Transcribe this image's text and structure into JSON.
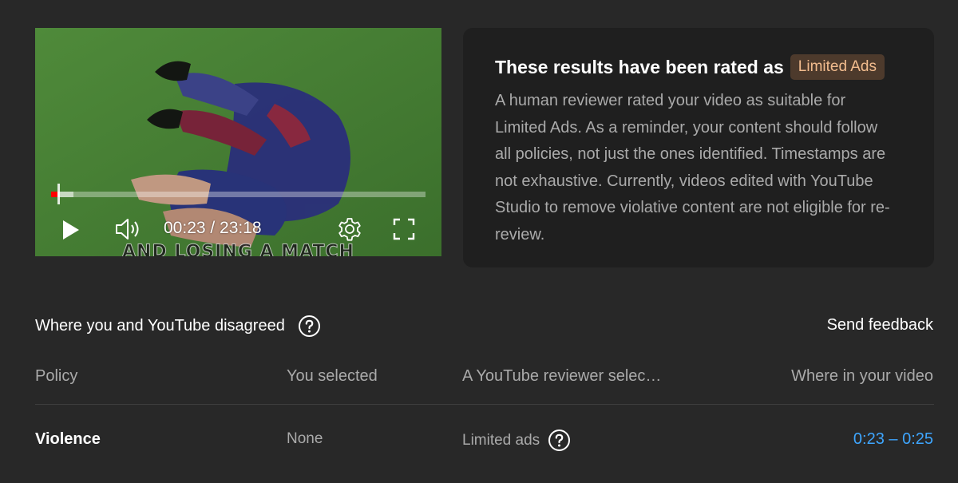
{
  "player": {
    "caption": "AND LOSING A MATCH",
    "time": "00:23 / 23:18",
    "progress_played_pct": 1.6,
    "progress_buffered_pct": 6.0,
    "icons": [
      "play-icon",
      "volume-icon",
      "settings-gear-icon",
      "fullscreen-icon"
    ]
  },
  "card": {
    "title": "These results have been rated as",
    "badge": "Limited Ads",
    "body": "A human reviewer rated your video as suitable for Limited Ads. As a reminder, your content should follow all policies, not just the ones identified. Timestamps are not exhaustive. Currently, videos edited with YouTube Studio to remove violative content are not eligible for re-review."
  },
  "disagreement": {
    "heading": "Where you and YouTube disagreed",
    "send_feedback": "Send feedback"
  },
  "table": {
    "headers": [
      "Policy",
      "You selected",
      "A YouTube reviewer selec…",
      "Where in your video"
    ],
    "rows": [
      {
        "policy": "Violence",
        "you_selected": "None",
        "reviewer_selected": "Limited ads",
        "where": "0:23 – 0:25"
      }
    ]
  },
  "colors": {
    "background": "#282828",
    "card": "#1f1f1f",
    "badge_bg": "#4d3a2c",
    "badge_text": "#f2bc8e",
    "link": "#3ea6ff",
    "progress": "#ff0000"
  }
}
